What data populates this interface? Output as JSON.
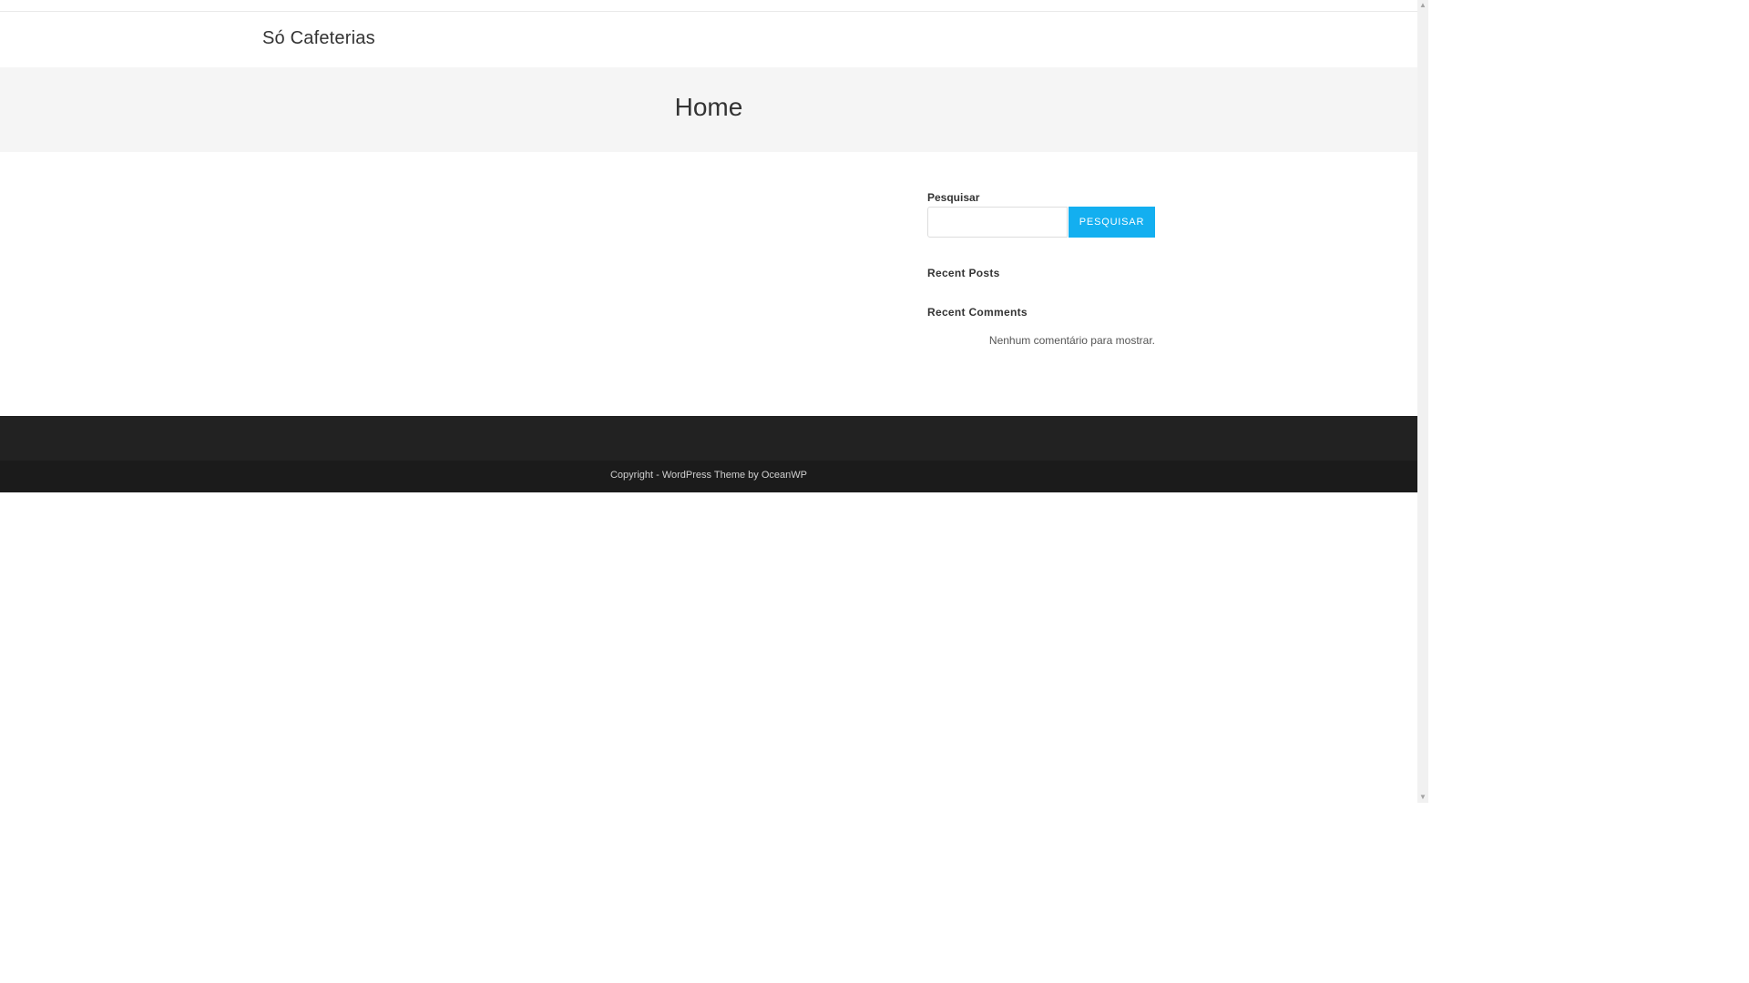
{
  "header": {
    "site_title": "Só Cafeterias"
  },
  "page_header": {
    "title": "Home"
  },
  "sidebar": {
    "search": {
      "label": "Pesquisar",
      "value": "",
      "button_label": "PESQUISAR"
    },
    "recent_posts": {
      "title": "Recent Posts"
    },
    "recent_comments": {
      "title": "Recent Comments",
      "empty_text": "Nenhum comentário para mostrar."
    }
  },
  "footer": {
    "copyright": "Copyright - WordPress Theme by OceanWP"
  },
  "scrollbar": {
    "up_icon": "chevron-up-icon",
    "down_icon": "chevron-down-icon"
  },
  "colors": {
    "accent": "#13aff0",
    "footer_widgets_bg": "#222222",
    "footer_bottom_bg": "#1b1b1b",
    "page_header_bg": "#f5f5f5"
  }
}
